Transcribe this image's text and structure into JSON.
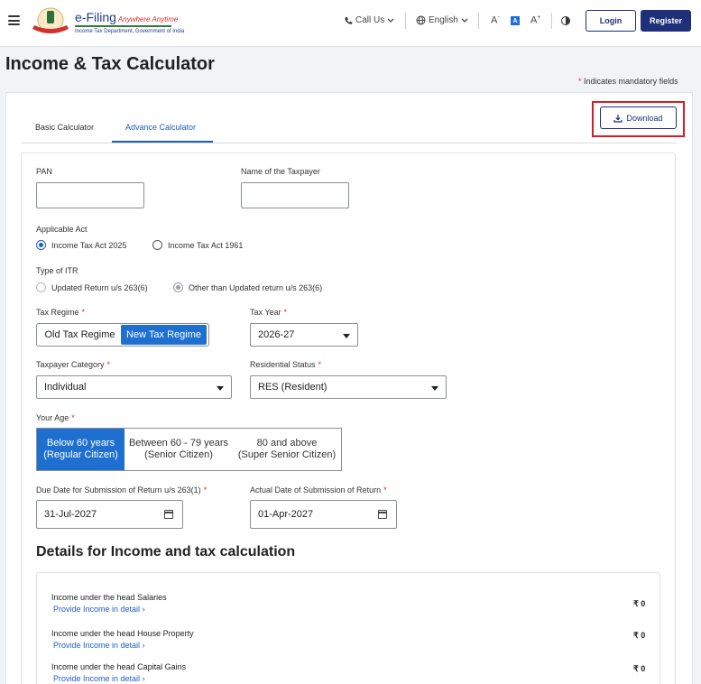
{
  "header": {
    "brand_title": "e-Filing",
    "brand_tagline": "Anywhere Anytime",
    "brand_sub": "Income Tax Department, Government of India",
    "call_us": "Call Us",
    "language": "English",
    "font_decrease": "A",
    "font_normal": "A",
    "font_increase": "A",
    "login": "Login",
    "register": "Register"
  },
  "page": {
    "title": "Income & Tax Calculator",
    "mandatory_note": "Indicates mandatory fields",
    "mandatory_star": "*"
  },
  "tabs": [
    {
      "label": "Basic Calculator",
      "active": false
    },
    {
      "label": "Advance Calculator",
      "active": true
    }
  ],
  "download_label": "Download",
  "form": {
    "pan_label": "PAN",
    "pan_value": "",
    "name_label": "Name of the Taxpayer",
    "name_value": "",
    "act_label": "Applicable Act",
    "act_options": [
      "Income Tax Act 2025",
      "Income Tax Act 1961"
    ],
    "act_selected": "Income Tax Act 2025",
    "itr_label": "Type of ITR",
    "itr_options": [
      "Updated Return u/s 263(6)",
      "Other than Updated return u/s 263(6)"
    ],
    "itr_selected": "Other than Updated return u/s 263(6)",
    "regime_label": "Tax Regime",
    "regime_options": [
      "Old Tax Regime",
      "New Tax Regime"
    ],
    "regime_selected": "New Tax Regime",
    "tax_year_label": "Tax Year",
    "tax_year_value": "2026-27",
    "category_label": "Taxpayer Category",
    "category_value": "Individual",
    "residential_label": "Residential Status",
    "residential_value": "RES (Resident)",
    "age_label": "Your Age",
    "age_options": [
      {
        "line1": "Below 60 years",
        "line2": "(Regular Citizen)"
      },
      {
        "line1": "Between 60 - 79 years",
        "line2": "(Senior Citizen)"
      },
      {
        "line1": "80 and above",
        "line2": "(Super Senior Citizen)"
      }
    ],
    "age_selected_index": 0,
    "due_date_label": "Due Date for Submission of Return u/s 263(1)",
    "due_date_value": "31-Jul-2027",
    "actual_date_label": "Actual Date of Submission of Return",
    "actual_date_value": "01-Apr-2027",
    "required_marker": "*"
  },
  "details": {
    "title": "Details for Income and tax calculation",
    "rows": [
      {
        "label": "Income under the head Salaries",
        "link": "Provide Income in detail",
        "value": "₹ 0"
      },
      {
        "label": "Income under the head House Property",
        "link": "Provide Income in detail",
        "value": "₹ 0"
      },
      {
        "label": "Income under the head Capital Gains",
        "link": "Provide Income in detail",
        "value": "₹ 0"
      }
    ]
  },
  "colors": {
    "primary": "#1f2f7a",
    "accent_blue": "#1f6fd0",
    "highlight_red": "#d81b24",
    "required_red": "#d32f2f"
  }
}
